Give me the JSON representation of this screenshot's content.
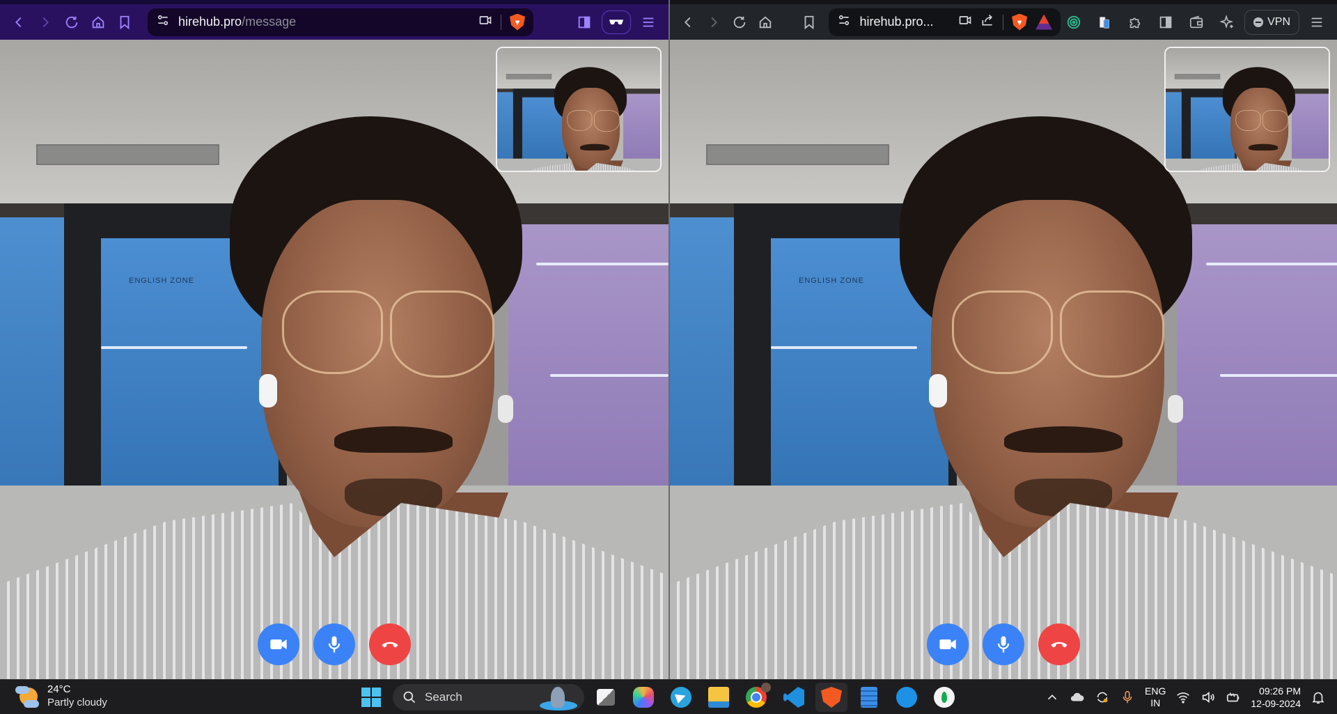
{
  "left_browser": {
    "url_domain": "hirehub.pro",
    "url_path": "/message",
    "icons": {
      "back": "chevron-left-icon",
      "forward": "chevron-right-icon",
      "reload": "reload-icon",
      "home": "home-icon",
      "bookmark": "bookmark-icon",
      "site_settings": "sliders-icon",
      "camera": "camera-icon",
      "brave_shield": "brave-lion-icon",
      "sidebar": "sidebar-icon",
      "private": "private-glasses-icon",
      "menu": "hamburger-menu-icon"
    },
    "theme_color": "#2a1160"
  },
  "right_browser": {
    "url_display": "hirehub.pro...",
    "vpn_label": "VPN",
    "theme_color": "#22262b"
  },
  "call": {
    "controls": [
      {
        "name": "camera-toggle",
        "icon": "video-camera-icon",
        "color": "#3b82f6"
      },
      {
        "name": "mic-toggle",
        "icon": "microphone-icon",
        "color": "#3b82f6"
      },
      {
        "name": "end-call",
        "icon": "phone-hangup-icon",
        "color": "#ef4444"
      }
    ],
    "background_sign": "ENGLISH ZONE"
  },
  "taskbar": {
    "weather_temp": "24°C",
    "weather_desc": "Partly cloudy",
    "search_placeholder": "Search",
    "apps": [
      "Task View",
      "Copilot",
      "Telegram",
      "File Explorer",
      "Chrome",
      "VS Code",
      "Brave",
      "Notepad",
      "Docker",
      "MongoDB Compass"
    ],
    "lang_line1": "ENG",
    "lang_line2": "IN",
    "time": "09:26 PM",
    "date": "12-09-2024"
  }
}
